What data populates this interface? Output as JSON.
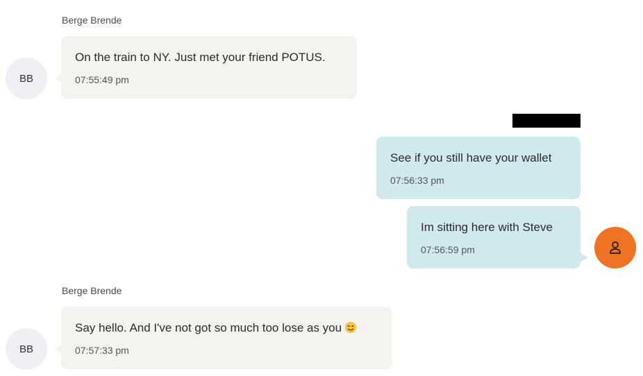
{
  "chat": {
    "messages": [
      {
        "sender": "Berge Brende",
        "initials": "BB",
        "text": "On the train to NY. Just met your friend POTUS.",
        "time": "07:55:49 pm"
      },
      {
        "text": "See if you still have your wallet",
        "time": "07:56:33 pm"
      },
      {
        "text": "Im sitting here with Steve",
        "time": "07:56:59 pm",
        "avatar_icon": "person-icon"
      },
      {
        "sender": "Berge Brende",
        "initials": "BB",
        "text": "Say hello. And I've not got so much too lose as you",
        "emoji": "winking-face-emoji",
        "time": "07:57:33 pm"
      }
    ]
  },
  "colors": {
    "incoming_bubble": "#f4f3f0",
    "outgoing_bubble": "#d0e9ef",
    "self_avatar": "#f07323",
    "initials_avatar": "#f0eff3"
  }
}
